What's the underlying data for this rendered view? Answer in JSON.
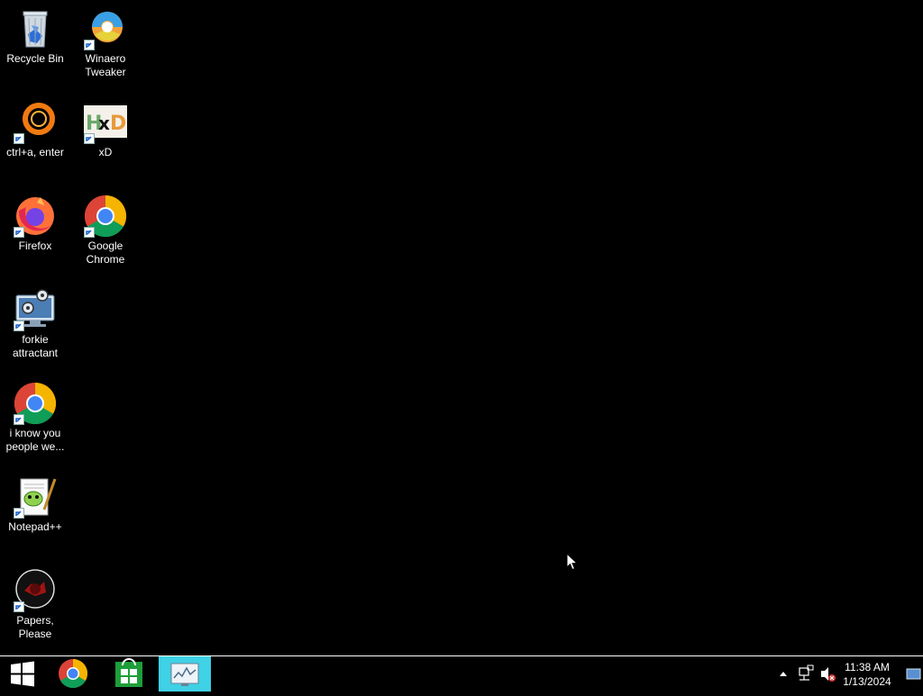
{
  "desktop": {
    "icons": [
      {
        "label": "Recycle Bin",
        "icon": "recycle-bin-icon"
      },
      {
        "label": "Winaero Tweaker",
        "icon": "winaero-tweaker-icon"
      },
      {
        "label": "ctrl+a, enter",
        "icon": "ring-app-icon"
      },
      {
        "label": "xD",
        "icon": "hxd-icon"
      },
      {
        "label": "Firefox",
        "icon": "firefox-icon"
      },
      {
        "label": "Google Chrome",
        "icon": "chrome-icon"
      },
      {
        "label": "forkie attractant",
        "icon": "computer-gears-icon"
      },
      {
        "label": "i know you people we...",
        "icon": "chrome-icon"
      },
      {
        "label": "Notepad++",
        "icon": "notepad-plus-plus-icon"
      },
      {
        "label": "Papers, Please",
        "icon": "papers-please-icon"
      }
    ]
  },
  "taskbar": {
    "buttons": [
      {
        "name": "start",
        "icon": "windows-logo-icon"
      },
      {
        "name": "chrome",
        "icon": "chrome-icon"
      },
      {
        "name": "store",
        "icon": "store-icon"
      },
      {
        "name": "task-manager",
        "icon": "monitor-app-icon",
        "active": true
      }
    ],
    "tray": {
      "icons": [
        "chevron-up-icon",
        "network-icon",
        "volume-muted-icon",
        "show-desktop-icon"
      ],
      "time": "11:38 AM",
      "date": "1/13/2024"
    }
  },
  "colors": {
    "desktop_bg": "#000000",
    "taskbar_bg": "#000000",
    "active_taskbar_button": "#3fd1e6"
  }
}
